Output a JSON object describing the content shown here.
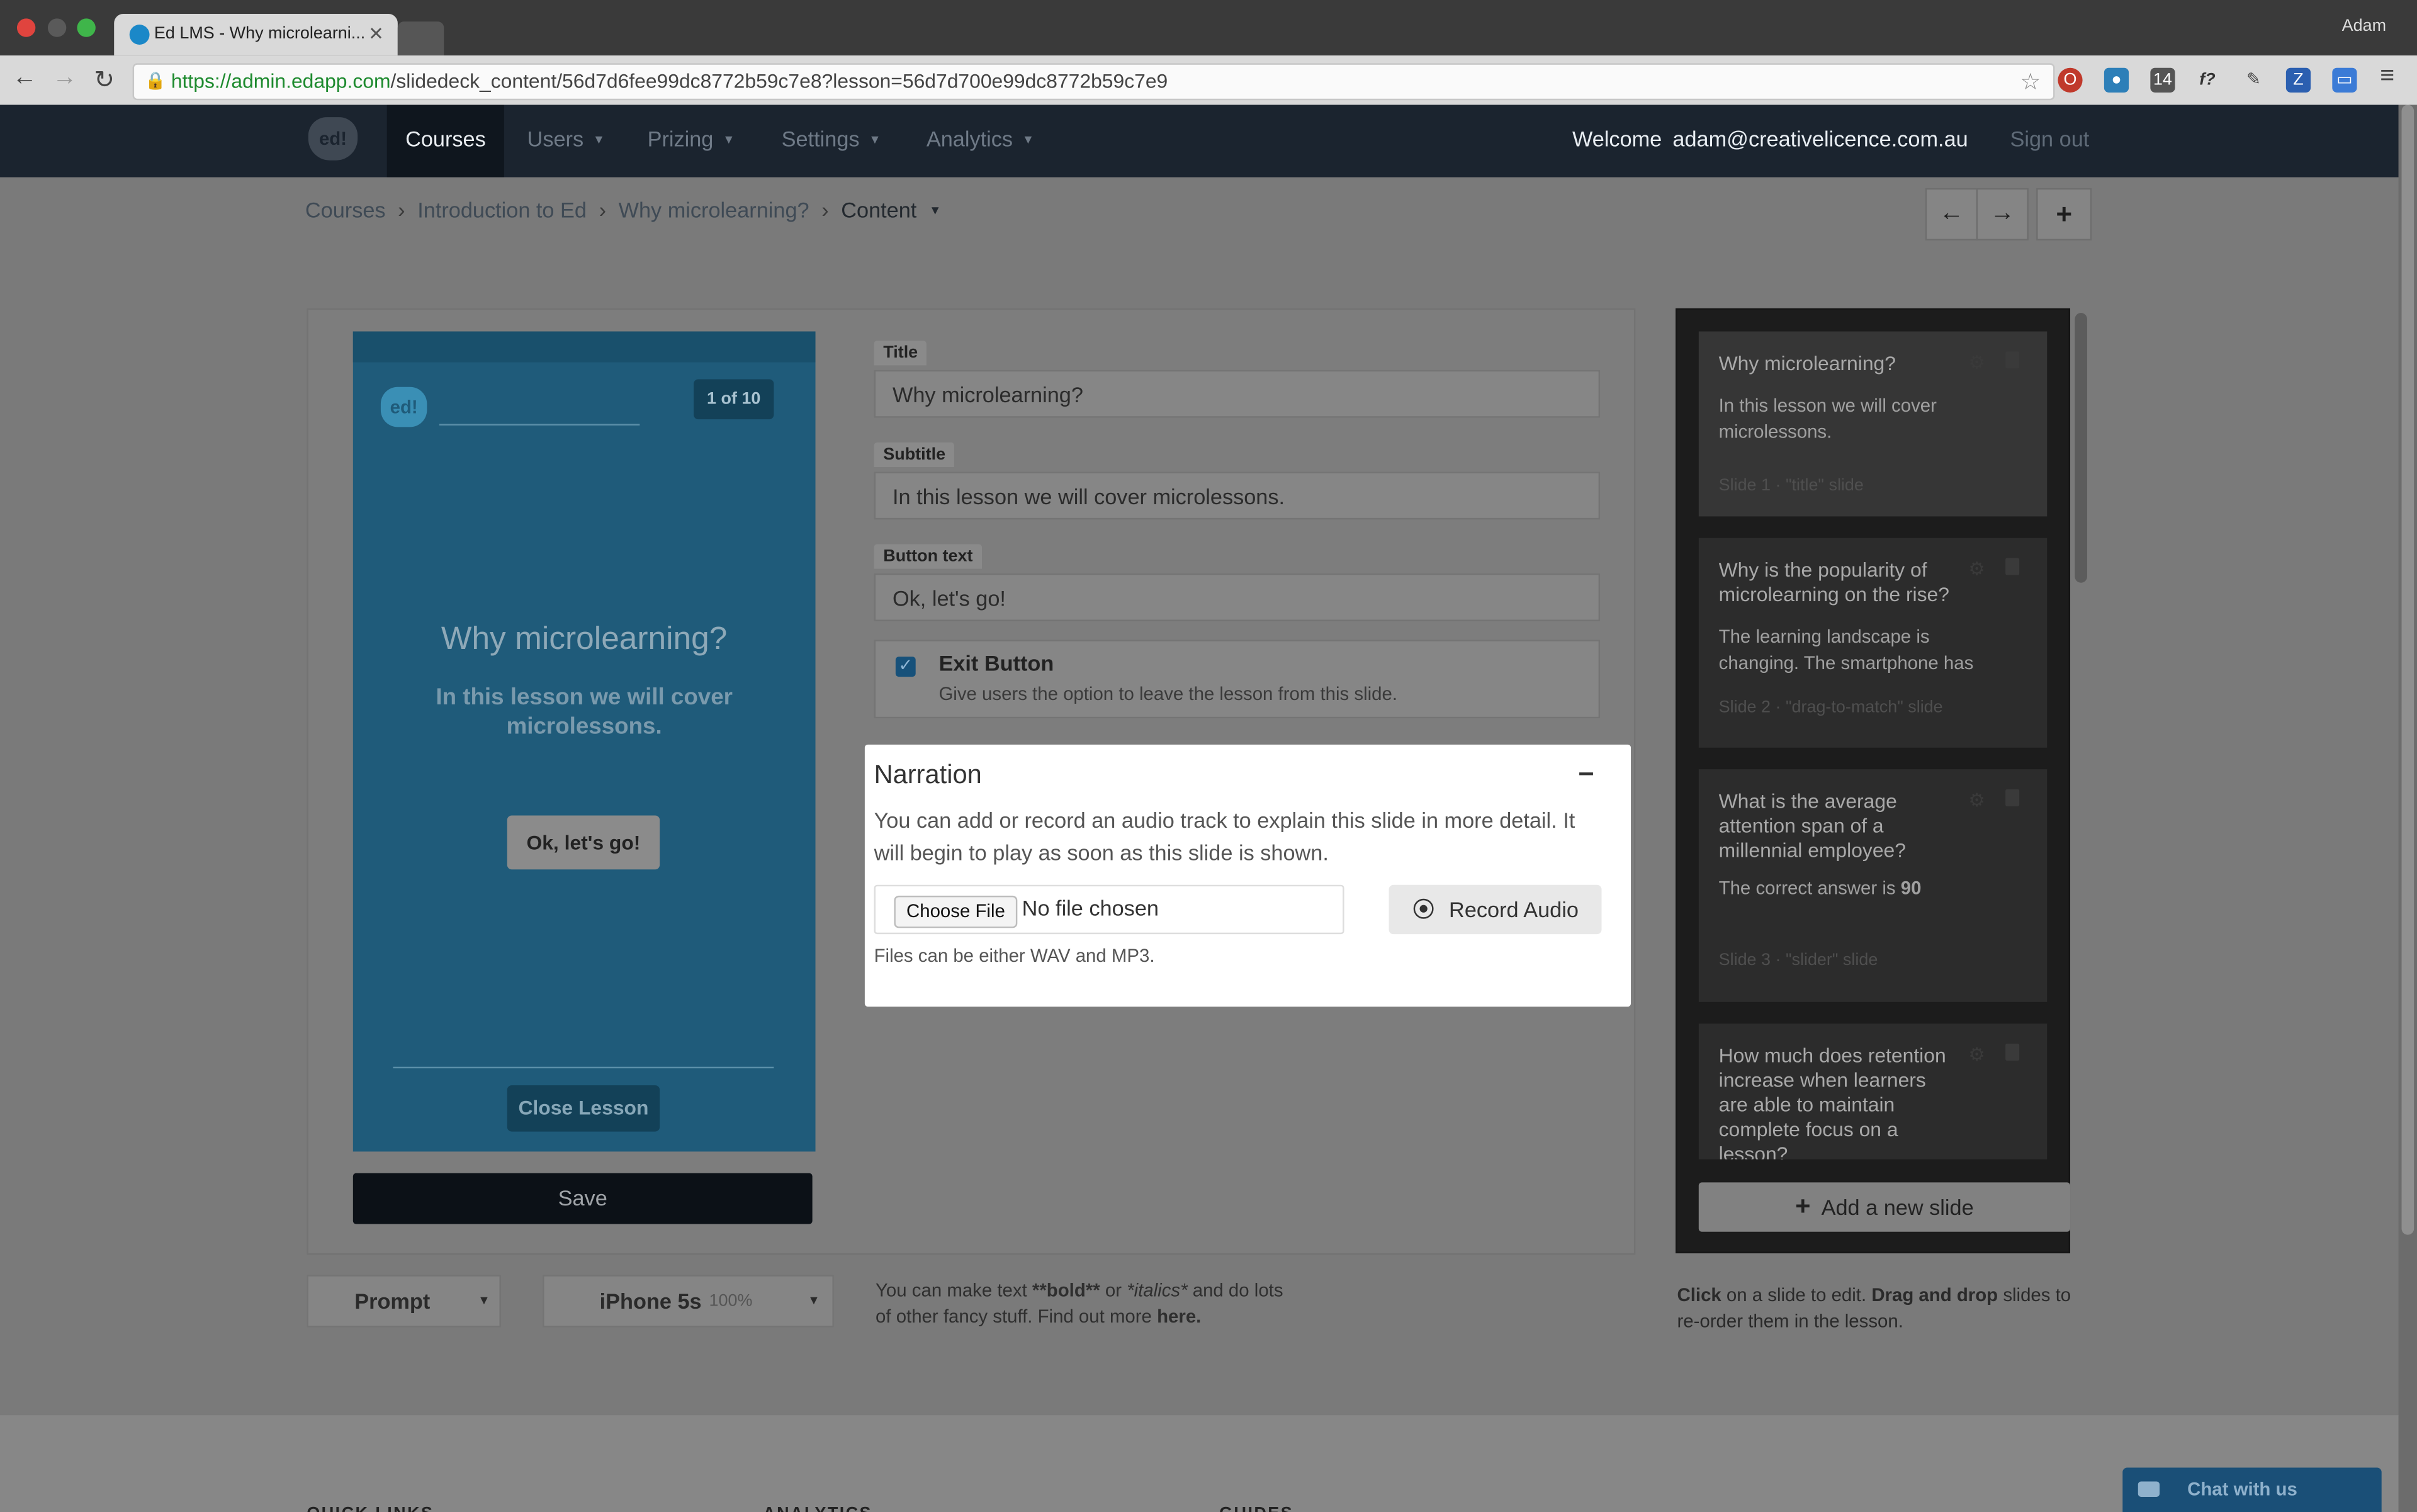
{
  "browser": {
    "tab_title": "Ed LMS - Why microlearni...",
    "profile_name": "Adam",
    "url_host": "https://admin.edapp.com",
    "url_path": "/slidedeck_content/56d7d6fee99dc8772b59c7e8?lesson=56d7d700e99dc8772b59c7e9"
  },
  "nav": {
    "logo": "ed!",
    "items": [
      "Courses",
      "Users",
      "Prizing",
      "Settings",
      "Analytics"
    ],
    "welcome_label": "Welcome",
    "welcome_email": "adam@creativelicence.com.au",
    "signout": "Sign out"
  },
  "breadcrumb": {
    "items": [
      "Courses",
      "Introduction to Ed",
      "Why microlearning?"
    ],
    "current": "Content",
    "separator": "›"
  },
  "preview": {
    "logo": "ed!",
    "counter": "1 of 10",
    "title": "Why microlearning?",
    "subtitle": "In this lesson we will cover microlessons.",
    "button": "Ok, let's go!",
    "close_button": "Close Lesson",
    "save": "Save"
  },
  "form": {
    "title_label": "Title",
    "title_value": "Why microlearning?",
    "subtitle_label": "Subtitle",
    "subtitle_value": "In this lesson we will cover microlessons.",
    "button_text_label": "Button text",
    "button_text_value": "Ok, let's go!",
    "exit_button_label": "Exit Button",
    "exit_button_desc": "Give users the option to leave the lesson from this slide.",
    "exit_button_checked": true
  },
  "narration": {
    "title": "Narration",
    "description": "You can add or record an audio track to explain this slide in more detail. It will begin to play as soon as this slide is shown.",
    "choose_file": "Choose File",
    "no_file": "No file chosen",
    "record_audio": "Record Audio",
    "hint": "Files can be either WAV and MP3."
  },
  "bottom_controls": {
    "template_select": "Prompt",
    "device_select": "iPhone 5s",
    "device_zoom": "100%",
    "help_part1": "You can make text ",
    "help_bold": "**bold**",
    "help_part2": " or ",
    "help_italic": "*italics*",
    "help_part3": " and do lots of other fancy stuff. Find out more ",
    "help_link": "here."
  },
  "slides": [
    {
      "title": "Why microlearning?",
      "body": "In this lesson we will cover microlessons.",
      "meta": "Slide 1 · \"title\" slide"
    },
    {
      "title": "Why is the popularity of microlearning on the rise?",
      "body": "The learning landscape is changing. The smartphone has",
      "meta": "Slide 2 · \"drag-to-match\" slide"
    },
    {
      "title": "What is the average attention span of a millennial employee?",
      "body": "The correct answer is ",
      "body_bold": "90",
      "meta": "Slide 3 · \"slider\" slide"
    },
    {
      "title": "How much does retention increase when learners are able to maintain complete focus on a lesson?",
      "body": "",
      "meta": ""
    }
  ],
  "sidebar": {
    "add_slide": "Add a new slide",
    "hint_click": "Click",
    "hint_part1": " on a slide to edit. ",
    "hint_drag": "Drag and drop",
    "hint_part2": " slides to re-order them in the lesson."
  },
  "footer": {
    "headings": [
      "QUICK LINKS",
      "ANALYTICS",
      "GUIDES"
    ]
  },
  "chat": {
    "label": "Chat with us"
  },
  "colors": {
    "nav_bg": "#1b242f",
    "phone_bg": "#1f5b7a",
    "save_bg": "#0c1117",
    "chat_bg": "#1a4f77"
  }
}
